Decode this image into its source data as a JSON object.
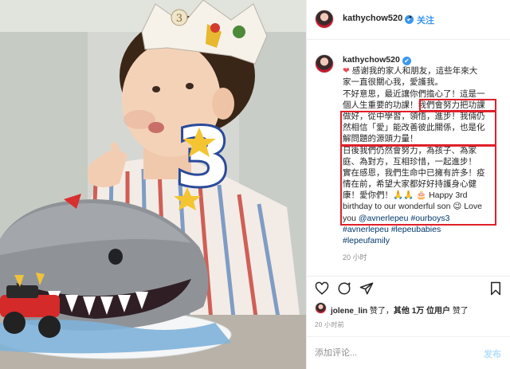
{
  "post": {
    "username": "kathychow520",
    "follow_label": "关注",
    "header_separator": "•",
    "verified_mark": "✔",
    "caption": {
      "username": "kathychow520",
      "lines": [
        "感谢我的家人和朋友，這些年來大",
        "家一直很關心我，愛護我。",
        "不好意思，最近讓你們擔心了！這是一",
        "個人生重要的功課！我們會努力把功課",
        "做好，從中學習，領悟，進步！我倆仍",
        "然相信「愛」能改善彼此關係，也是化",
        "解問題的源頭力量！",
        "日後我們仍然會努力，為孩子、為家",
        "庭、為對方，互相珍惜，一起進步！",
        "實在感恩，我們生命中已擁有許多！疫",
        "情在前，希望大家都好好持護身心健",
        "康！愛你們！",
        "birthday to our wonderful son",
        "Love"
      ],
      "emoji_pray": "🙏🙏",
      "emoji_cake": "🎂",
      "emoji_wink": "😉",
      "happy_3rd": "Happy 3rd",
      "you": "you",
      "mention": "@avnerlepeu",
      "hashtags": [
        "#ourboys3",
        "#avnerlepeu",
        "#lepeubabies",
        "#lepeufamily"
      ]
    },
    "caption_time": "20 小时",
    "likes": {
      "liker": "jolene_lin",
      "liked_word": "赞了",
      "others_prefix": "其他",
      "others_count": "1万",
      "others_suffix": "位用户"
    },
    "post_time": "20 小时前",
    "comment": {
      "placeholder": "添加评论...",
      "post_label": "发布"
    }
  },
  "photo": {
    "crown_number": "3",
    "big_number": "3"
  },
  "icons": {
    "like": "heart-icon",
    "comment": "comment-icon",
    "share": "share-icon",
    "save": "bookmark-icon"
  },
  "colors": {
    "accent_blue": "#3897f0",
    "highlight_box": "#e0202a",
    "link": "#00376b"
  }
}
